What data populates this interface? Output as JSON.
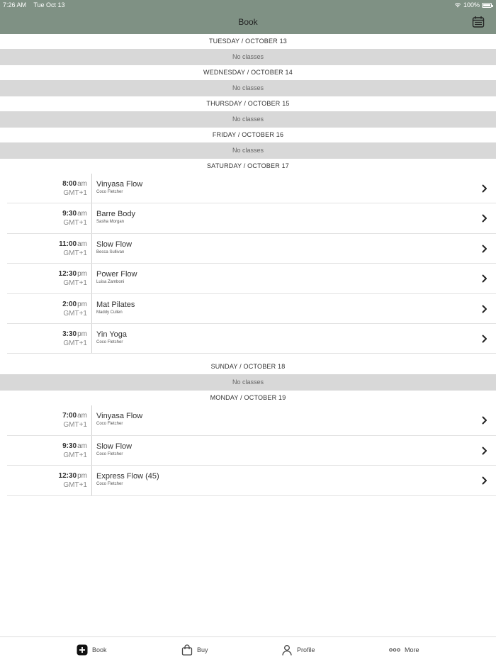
{
  "status_bar": {
    "time": "7:26 AM",
    "date": "Tue Oct 13",
    "battery_percent": "100%",
    "battery_level": 1.0
  },
  "nav": {
    "title": "Book",
    "calendar_icon": "calendar-icon"
  },
  "days": [
    {
      "header": "TUESDAY / OCTOBER 13",
      "empty_text": "No classes",
      "classes": []
    },
    {
      "header": "WEDNESDAY / OCTOBER 14",
      "empty_text": "No classes",
      "classes": []
    },
    {
      "header": "THURSDAY / OCTOBER 15",
      "empty_text": "No classes",
      "classes": []
    },
    {
      "header": "FRIDAY / OCTOBER 16",
      "empty_text": "No classes",
      "classes": []
    },
    {
      "header": "SATURDAY / OCTOBER 17",
      "empty_text": "",
      "classes": [
        {
          "time": "8:00",
          "ampm": "am",
          "tz": "GMT+1",
          "name": "Vinyasa Flow",
          "instructor": "Coco Fletcher"
        },
        {
          "time": "9:30",
          "ampm": "am",
          "tz": "GMT+1",
          "name": "Barre Body",
          "instructor": "Sasha Morgan"
        },
        {
          "time": "11:00",
          "ampm": "am",
          "tz": "GMT+1",
          "name": "Slow Flow",
          "instructor": "Becca Sullivan"
        },
        {
          "time": "12:30",
          "ampm": "pm",
          "tz": "GMT+1",
          "name": "Power Flow",
          "instructor": "Luisa Zamboni"
        },
        {
          "time": "2:00",
          "ampm": "pm",
          "tz": "GMT+1",
          "name": "Mat Pilates",
          "instructor": "Maddy Cullen"
        },
        {
          "time": "3:30",
          "ampm": "pm",
          "tz": "GMT+1",
          "name": "Yin Yoga",
          "instructor": "Coco Fletcher"
        }
      ]
    },
    {
      "header": "SUNDAY / OCTOBER 18",
      "empty_text": "No classes",
      "classes": []
    },
    {
      "header": "MONDAY / OCTOBER 19",
      "empty_text": "",
      "classes": [
        {
          "time": "7:00",
          "ampm": "am",
          "tz": "GMT+1",
          "name": "Vinyasa Flow",
          "instructor": "Coco Fletcher"
        },
        {
          "time": "9:30",
          "ampm": "am",
          "tz": "GMT+1",
          "name": "Slow Flow",
          "instructor": "Coco Fletcher"
        },
        {
          "time": "12:30",
          "ampm": "pm",
          "tz": "GMT+1",
          "name": "Express Flow (45)",
          "instructor": "Coco Fletcher"
        }
      ]
    }
  ],
  "tabs": [
    {
      "label": "Book",
      "icon": "plus-square-icon",
      "active": true
    },
    {
      "label": "Buy",
      "icon": "shopping-bag-icon",
      "active": false
    },
    {
      "label": "Profile",
      "icon": "person-icon",
      "active": false
    },
    {
      "label": "More",
      "icon": "ellipsis-icon",
      "active": false
    }
  ],
  "colors": {
    "header_bg": "#7f9184",
    "empty_row_bg": "#d8d8d8"
  }
}
